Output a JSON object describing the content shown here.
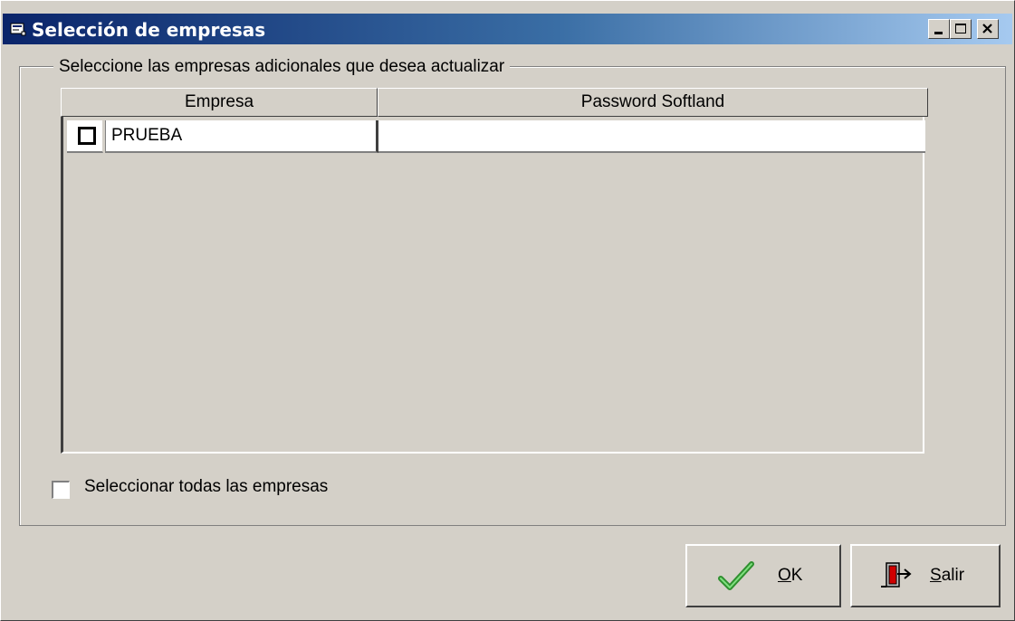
{
  "window": {
    "title": "Selección de empresas",
    "controls": [
      "minimize",
      "maximize",
      "close"
    ]
  },
  "group": {
    "legend": "Seleccione las empresas adicionales que desea actualizar"
  },
  "grid": {
    "columns": [
      "Empresa",
      "Password Softland"
    ],
    "rows": [
      {
        "checked": false,
        "empresa": "PRUEBA",
        "password": ""
      }
    ]
  },
  "select_all": {
    "label": "Seleccionar todas las empresas",
    "checked": false
  },
  "buttons": {
    "ok": {
      "mnemonic": "O",
      "rest": "K",
      "icon": "checkmark-icon"
    },
    "salir": {
      "mnemonic": "S",
      "rest": "alir",
      "icon": "exit-door-icon"
    }
  },
  "colors": {
    "titlebar_start": "#0a246a",
    "titlebar_end": "#a6caf0",
    "face": "#d4d0c8"
  }
}
